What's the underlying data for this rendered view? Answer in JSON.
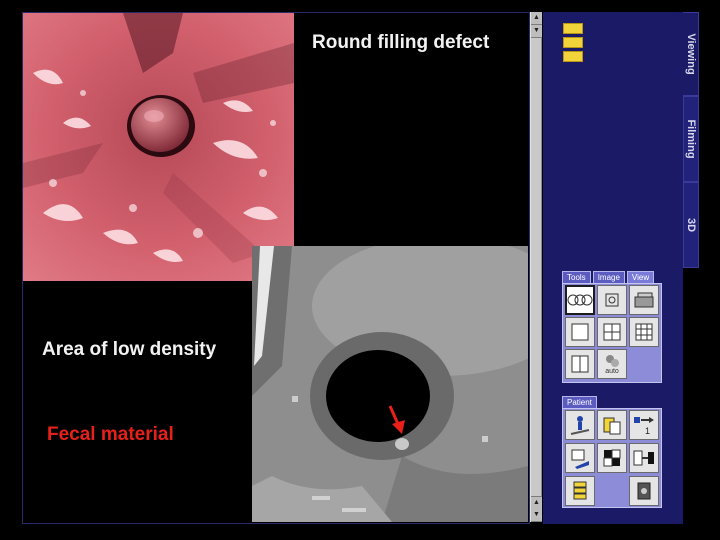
{
  "captions": {
    "round": "Round filling defect",
    "area": "Area of low density",
    "fecal": "Fecal material"
  },
  "side_tabs": [
    "Viewing",
    "Filming",
    "3D"
  ],
  "tool_panel": {
    "tabs": [
      "Tools",
      "Image",
      "View"
    ],
    "active_tab": "View",
    "buttons": [
      "layout-1x1-overview-icon",
      "stack-icon",
      "volume-view-icon",
      "layout-1x1-icon",
      "layout-2x2-icon",
      "layout-3x3-icon",
      "layout-1x2-icon",
      "auto-layout-icon"
    ],
    "auto_label": "auto"
  },
  "patient_panel": {
    "tab": "Patient",
    "buttons": [
      "patient-table-icon",
      "copy-series-icon",
      "move-series-icon",
      "save-icon",
      "checkerboard-icon",
      "transfer-icon",
      "series-list-icon",
      "archive-icon"
    ],
    "move_label": "1"
  },
  "colors": {
    "annotation_red": "#e8201a",
    "panel_blue": "#1a1a66",
    "endo_pink": "#d45b6a"
  }
}
